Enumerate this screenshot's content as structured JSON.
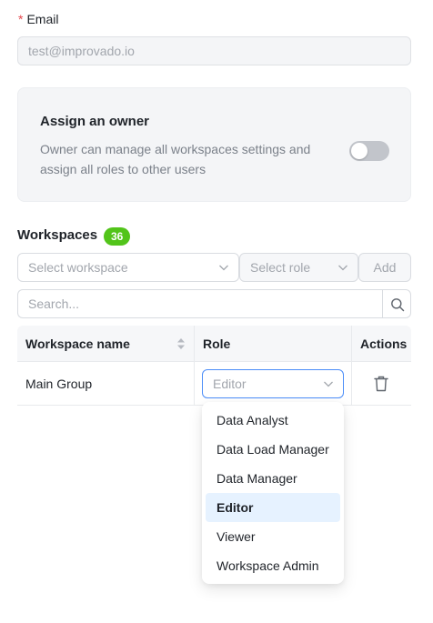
{
  "email": {
    "required_mark": "*",
    "label": "Email",
    "value": "test@improvado.io"
  },
  "owner": {
    "title": "Assign an owner",
    "description": "Owner can manage all workspaces settings and assign all roles to other users",
    "toggle_on": false
  },
  "workspaces": {
    "title": "Workspaces",
    "count": "36",
    "select_workspace_placeholder": "Select workspace",
    "select_role_placeholder": "Select role",
    "add_label": "Add",
    "search_placeholder": "Search..."
  },
  "table": {
    "columns": [
      "Workspace name",
      "Role",
      "Actions"
    ],
    "rows": [
      {
        "name": "Main Group",
        "role": "Editor"
      }
    ]
  },
  "role_dropdown": {
    "options": [
      "Data Analyst",
      "Data Load Manager",
      "Data Manager",
      "Editor",
      "Viewer",
      "Workspace Admin"
    ],
    "selected": "Editor"
  },
  "colors": {
    "accent": "#4b8df8",
    "badge": "#52c41a",
    "required": "#e5484d",
    "selected_option_bg": "#e6f2ff"
  },
  "icons": [
    "chevron-down-icon",
    "search-icon",
    "sort-icon",
    "trash-icon"
  ]
}
